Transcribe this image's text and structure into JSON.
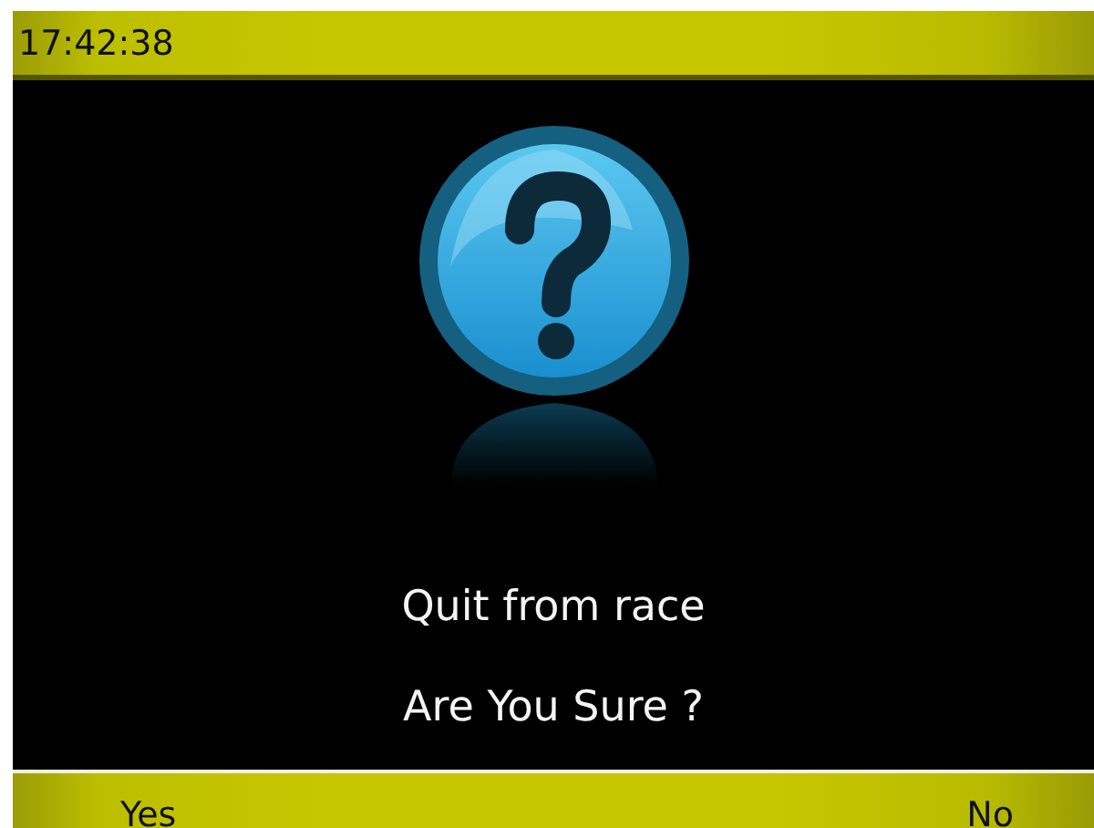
{
  "status_bar": {
    "time": "17:42:38"
  },
  "dialog": {
    "lines": [
      "Quit from race",
      "Are You Sure ?"
    ]
  },
  "softkeys": [
    {
      "label": "Yes"
    },
    {
      "label": "No"
    }
  ]
}
